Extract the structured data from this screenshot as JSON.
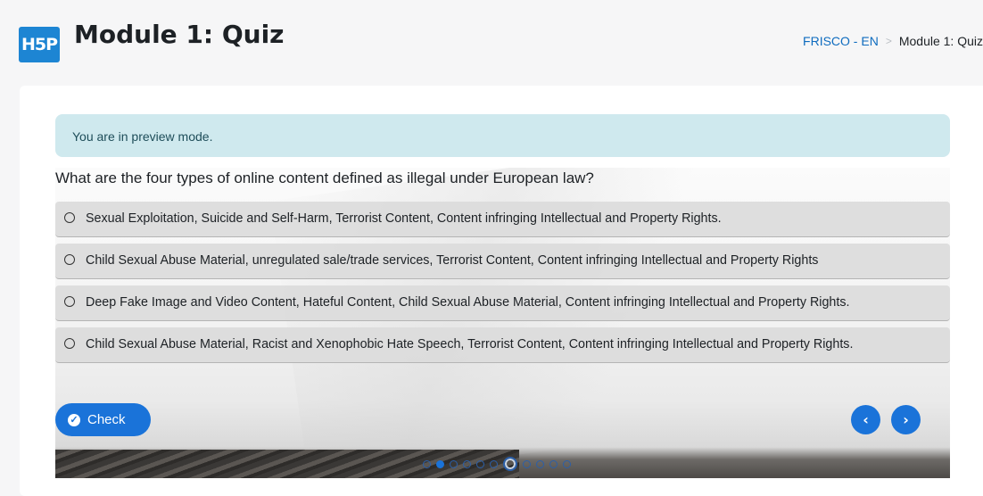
{
  "header": {
    "logo_text": "H5P",
    "title": "Module 1: Quiz"
  },
  "breadcrumb": {
    "items": [
      "FRISCO - EN",
      "Module 1: Quiz"
    ],
    "separator": ">"
  },
  "alert": {
    "text": "You are in preview mode."
  },
  "quiz": {
    "question": "What are the four types of online content defined as illegal under European law?",
    "answers": [
      "Sexual Exploitation, Suicide and Self-Harm, Terrorist Content, Content infringing Intellectual and Property Rights.",
      "Child Sexual Abuse Material, unregulated sale/trade services, Terrorist Content, Content infringing Intellectual and Property Rights",
      "Deep Fake Image and Video Content, Hateful Content, Child Sexual Abuse Material, Content infringing Intellectual and Property Rights.",
      "Child Sexual Abuse Material, Racist and Xenophobic Hate Speech, Terrorist Content, Content infringing Intellectual and Property Rights."
    ],
    "check_label": "Check",
    "progress": {
      "total": 11,
      "current": 7,
      "answered": [
        2
      ]
    }
  },
  "colors": {
    "accent": "#1a73d9",
    "logo_bg": "#1d85d3",
    "alert_bg": "#cfe9ee"
  },
  "icons": {
    "check": "check-circle-icon",
    "prev": "chevron-left-icon",
    "next": "chevron-right-icon",
    "radio": "radio-unchecked-icon"
  }
}
